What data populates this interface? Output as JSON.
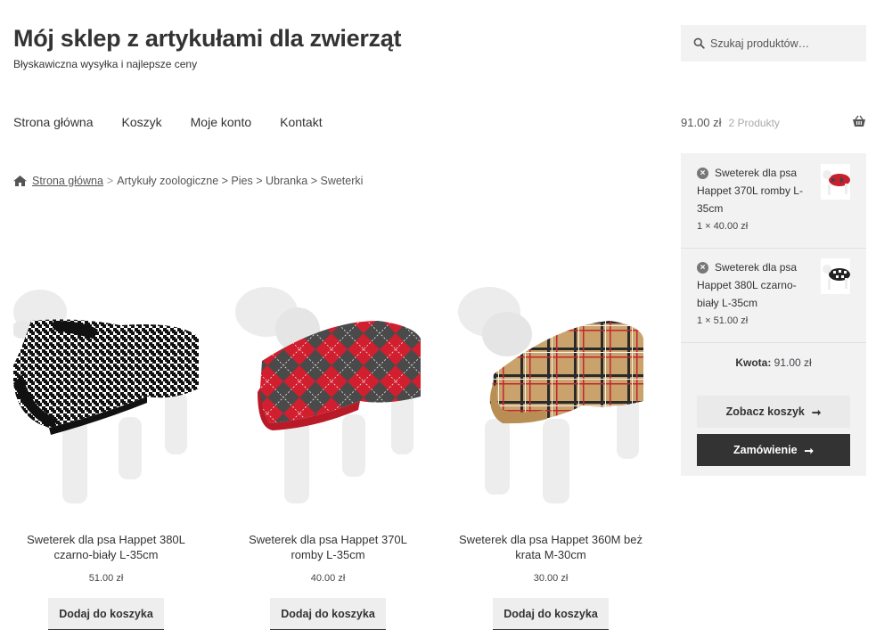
{
  "header": {
    "title": "Mój sklep z artykułami dla zwierząt",
    "tagline": "Błyskawiczna wysyłka i najlepsze ceny",
    "search_placeholder": "Szukaj produktów…"
  },
  "nav": {
    "items": [
      "Strona główna",
      "Koszyk",
      "Moje konto",
      "Kontakt"
    ]
  },
  "cart": {
    "amount": "91.00 zł",
    "count": "2 Produkty"
  },
  "minicart": {
    "items": [
      {
        "name": "Sweterek dla psa Happet 370L romby L-35cm",
        "qty": "1 × 40.00 zł",
        "remove": "×"
      },
      {
        "name": "Sweterek dla psa Happet 380L czarno-biały L-35cm",
        "qty": "1 × 51.00 zł",
        "remove": "×"
      }
    ],
    "total_label": "Kwota:",
    "total_value": "91.00 zł",
    "view_cart": "Zobacz koszyk",
    "checkout": "Zamówienie",
    "arrow": "➞"
  },
  "breadcrumb": {
    "home": "Strona główna",
    "sep": ">",
    "path": "Artykuły zoologiczne > Pies > Ubranka > Sweterki"
  },
  "products": [
    {
      "title": "Sweterek dla psa Happet 380L czarno-biały L-35cm",
      "price": "51.00 zł",
      "button": "Dodaj do koszyka"
    },
    {
      "title": "Sweterek dla psa Happet 370L romby L-35cm",
      "price": "40.00 zł",
      "button": "Dodaj do koszyka"
    },
    {
      "title": "Sweterek dla psa Happet 360M beż krata M-30cm",
      "price": "30.00 zł",
      "button": "Dodaj do koszyka"
    }
  ],
  "colors": {
    "accent_dark": "#333333",
    "panel_bg": "#f2f2f2",
    "houndstooth": "#111111",
    "argyle_red": "#d11f2f",
    "plaid_beige": "#c9a36b"
  }
}
